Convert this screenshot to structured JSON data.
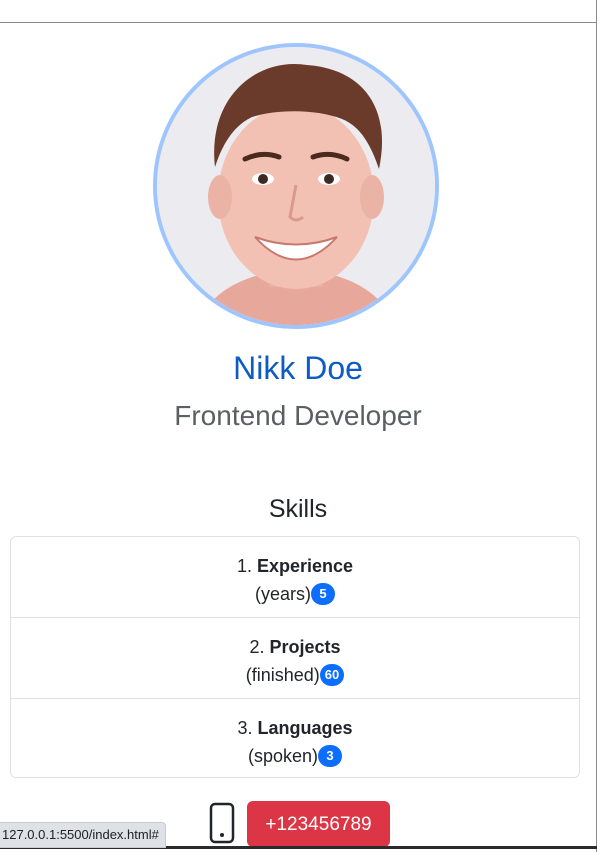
{
  "profile": {
    "name": "Nikk Doe",
    "title": "Frontend Developer"
  },
  "skills": {
    "heading": "Skills",
    "items": [
      {
        "number": "1.",
        "name": "Experience",
        "note": "(years)",
        "value": "5"
      },
      {
        "number": "2.",
        "name": "Projects",
        "note": "(finished)",
        "value": "60"
      },
      {
        "number": "3.",
        "name": "Languages",
        "note": "(spoken)",
        "value": "3"
      }
    ]
  },
  "contact": {
    "phone_icon": "mobile-phone-icon",
    "phone_label": "+123456789"
  },
  "status_bar": {
    "url": "127.0.0.1:5500/index.html#"
  },
  "colors": {
    "name": "#0d5bc4",
    "avatar_border": "#9ec5fe",
    "badge": "#0d6efd",
    "phone_button": "#dc3545"
  }
}
